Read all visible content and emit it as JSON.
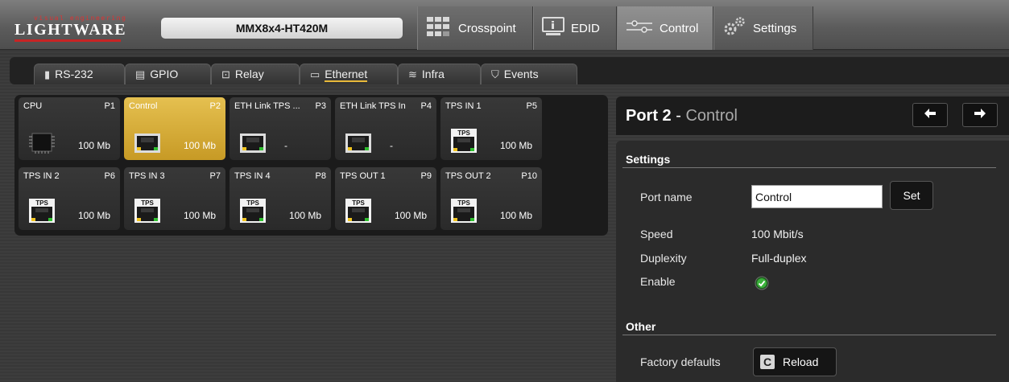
{
  "brand": {
    "tagline": "visual engineering",
    "name": "LIGHTWARE"
  },
  "device_name": "MMX8x4-HT420M",
  "nav": {
    "crosspoint": "Crosspoint",
    "edid": "EDID",
    "control": "Control",
    "settings": "Settings",
    "active": "Control"
  },
  "subtabs": {
    "rs232": "RS-232",
    "gpio": "GPIO",
    "relay": "Relay",
    "ethernet": "Ethernet",
    "infra": "Infra",
    "events": "Events",
    "active": "Ethernet"
  },
  "ports": [
    {
      "name": "CPU",
      "num": "P1",
      "speed": "100 Mb",
      "jack": "cpu-chip-icon"
    },
    {
      "name": "Control",
      "num": "P2",
      "speed": "100 Mb",
      "jack": "rj45-icon",
      "active": true
    },
    {
      "name": "ETH Link TPS ...",
      "num": "P3",
      "speed": "-",
      "jack": "rj45-icon"
    },
    {
      "name": "ETH Link TPS In",
      "num": "P4",
      "speed": "-",
      "jack": "rj45-icon"
    },
    {
      "name": "TPS IN 1",
      "num": "P5",
      "speed": "100 Mb",
      "jack": "tps-rj45-icon"
    },
    {
      "name": "TPS IN 2",
      "num": "P6",
      "speed": "100 Mb",
      "jack": "tps-rj45-icon"
    },
    {
      "name": "TPS IN 3",
      "num": "P7",
      "speed": "100 Mb",
      "jack": "tps-rj45-icon"
    },
    {
      "name": "TPS IN 4",
      "num": "P8",
      "speed": "100 Mb",
      "jack": "tps-rj45-icon"
    },
    {
      "name": "TPS OUT 1",
      "num": "P9",
      "speed": "100 Mb",
      "jack": "tps-rj45-icon"
    },
    {
      "name": "TPS OUT 2",
      "num": "P10",
      "speed": "100 Mb",
      "jack": "tps-rj45-icon"
    }
  ],
  "detail": {
    "port_num": "Port 2",
    "separator": " - ",
    "port_name": "Control",
    "settings_title": "Settings",
    "port_name_label": "Port name",
    "port_name_value": "Control",
    "set_label": "Set",
    "speed_label": "Speed",
    "speed_value": "100 Mbit/s",
    "duplexity_label": "Duplexity",
    "duplexity_value": "Full-duplex",
    "enable_label": "Enable",
    "enable_value": true,
    "other_title": "Other",
    "factory_label": "Factory defaults",
    "reload_label": "Reload",
    "reload_icon_glyph": "C"
  },
  "colors": {
    "accent": "#e8b93a",
    "active_port": "#d4a935",
    "enable_green": "#3bb13b",
    "brand_red": "#c72424"
  }
}
